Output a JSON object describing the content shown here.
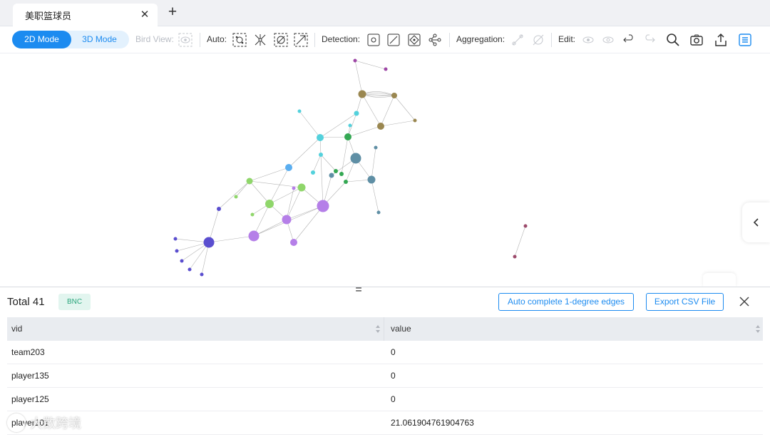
{
  "tabs": [
    {
      "label": "美职篮球员"
    }
  ],
  "toolbar": {
    "mode_2d": "2D Mode",
    "mode_3d": "3D Mode",
    "bird_view_label": "Bird View:",
    "auto_label": "Auto:",
    "detection_label": "Detection:",
    "aggregation_label": "Aggregation:",
    "edit_label": "Edit:",
    "accent_color": "#1c8bf0"
  },
  "panel": {
    "total_label": "Total 41",
    "algorithm_badge": "BNC",
    "auto_complete_button": "Auto complete 1-degree edges",
    "export_button": "Export CSV File",
    "columns": [
      "vid",
      "value"
    ],
    "rows": [
      {
        "vid": "team203",
        "value": "0"
      },
      {
        "vid": "player135",
        "value": "0"
      },
      {
        "vid": "player125",
        "value": "0"
      },
      {
        "vid": "player101",
        "value": "21.061904761904763"
      }
    ]
  },
  "watermark": {
    "text": "大数跨境"
  },
  "graph": {
    "colors": {
      "purple": "#9e47a6",
      "olive": "#9a8750",
      "cyan": "#53d1dc",
      "green": "#34a853",
      "teal": "#5f8fa5",
      "blue": "#5aaef0",
      "lightgreen": "#8fd66a",
      "violet": "#b57fe8",
      "indigo": "#5a4ecf",
      "maroon": "#9c4a6b"
    }
  }
}
